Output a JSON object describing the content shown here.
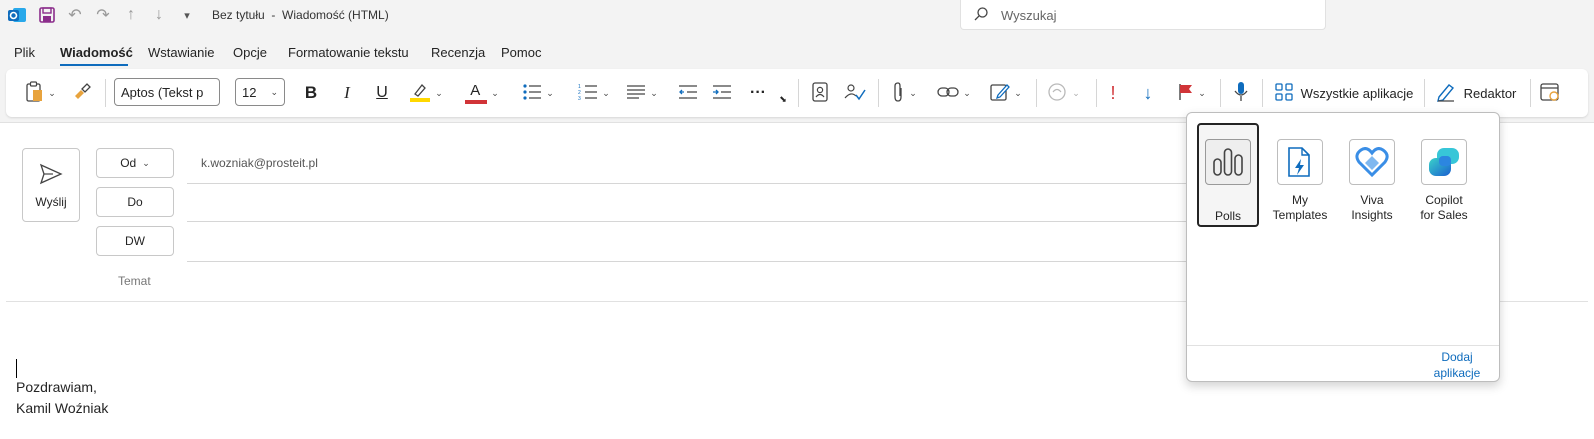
{
  "titlebar": {
    "title": "Bez tytułu  -  Wiadomość (HTML)",
    "search_placeholder": "Wyszukaj"
  },
  "menu": {
    "items": [
      "Plik",
      "Wiadomość",
      "Wstawianie",
      "Opcje",
      "Formatowanie tekstu",
      "Recenzja",
      "Pomoc"
    ],
    "active": "Wiadomość"
  },
  "ribbon": {
    "font_name": "Aptos (Tekst p",
    "font_size": "12",
    "bold": "B",
    "italic": "I",
    "underline": "U",
    "font_color_letter": "A",
    "more": "···",
    "importance_high": "!",
    "all_apps_label": "Wszystkie aplikacje",
    "editor_label": "Redaktor",
    "colors": {
      "accent": "#0f6cbd",
      "highlight": "#ffd800",
      "font_color": "#d13438",
      "flag": "#d13438"
    }
  },
  "compose": {
    "send_label": "Wyślij",
    "from_label": "Od",
    "from_email": "k.wozniak@prosteit.pl",
    "to_label": "Do",
    "cc_label": "DW",
    "subject_label": "Temat",
    "signature": [
      "Pozdrawiam,",
      "Kamil Woźniak"
    ]
  },
  "apps_flyout": {
    "apps": [
      {
        "name_line1": "Polls",
        "name_line2": "",
        "icon": "polls-icon",
        "selected": true
      },
      {
        "name_line1": "My",
        "name_line2": "Templates",
        "icon": "templates-icon",
        "selected": false
      },
      {
        "name_line1": "Viva",
        "name_line2": "Insights",
        "icon": "viva-insights-icon",
        "selected": false
      },
      {
        "name_line1": "Copilot",
        "name_line2": "for Sales",
        "icon": "copilot-icon",
        "selected": false
      }
    ],
    "add_apps_line1": "Dodaj",
    "add_apps_line2": "aplikacje"
  }
}
